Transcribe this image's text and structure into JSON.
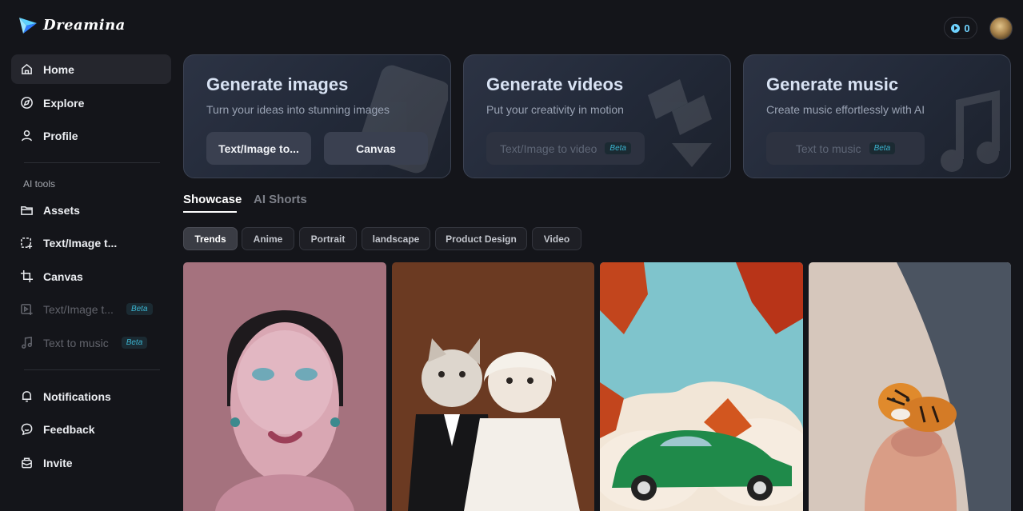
{
  "app": {
    "name": "Dreamina"
  },
  "header": {
    "credits": "0"
  },
  "sidebar": {
    "items": [
      {
        "label": "Home",
        "icon": "home-icon"
      },
      {
        "label": "Explore",
        "icon": "compass-icon"
      },
      {
        "label": "Profile",
        "icon": "user-icon"
      }
    ],
    "section_label": "AI tools",
    "tools": [
      {
        "label": "Assets",
        "icon": "folder-icon"
      },
      {
        "label": "Text/Image t...",
        "icon": "image-plus-icon"
      },
      {
        "label": "Canvas",
        "icon": "crop-icon"
      },
      {
        "label": "Text/Image t...",
        "icon": "video-plus-icon",
        "badge": "Beta"
      },
      {
        "label": "Text to music",
        "icon": "music-icon",
        "badge": "Beta"
      }
    ],
    "bottom": [
      {
        "label": "Notifications",
        "icon": "bell-icon"
      },
      {
        "label": "Feedback",
        "icon": "chat-icon"
      },
      {
        "label": "Invite",
        "icon": "gift-icon"
      }
    ]
  },
  "cards": [
    {
      "title": "Generate images",
      "subtitle": "Turn your ideas into stunning images",
      "buttons": [
        {
          "label": "Text/Image to..."
        },
        {
          "label": "Canvas"
        }
      ]
    },
    {
      "title": "Generate videos",
      "subtitle": "Put your creativity in motion",
      "buttons": [
        {
          "label": "Text/Image to video",
          "badge": "Beta"
        }
      ]
    },
    {
      "title": "Generate music",
      "subtitle": "Create music effortlessly with AI",
      "buttons": [
        {
          "label": "Text to music",
          "badge": "Beta"
        }
      ]
    }
  ],
  "tabs": [
    {
      "label": "Showcase"
    },
    {
      "label": "AI Shorts"
    }
  ],
  "filters": [
    {
      "label": "Trends"
    },
    {
      "label": "Anime"
    },
    {
      "label": "Portrait"
    },
    {
      "label": "landscape"
    },
    {
      "label": "Product Design"
    },
    {
      "label": "Video"
    }
  ],
  "colors": {
    "accent": "#6fd3ff",
    "beta": "#3bb3cf",
    "background": "#14151a"
  }
}
